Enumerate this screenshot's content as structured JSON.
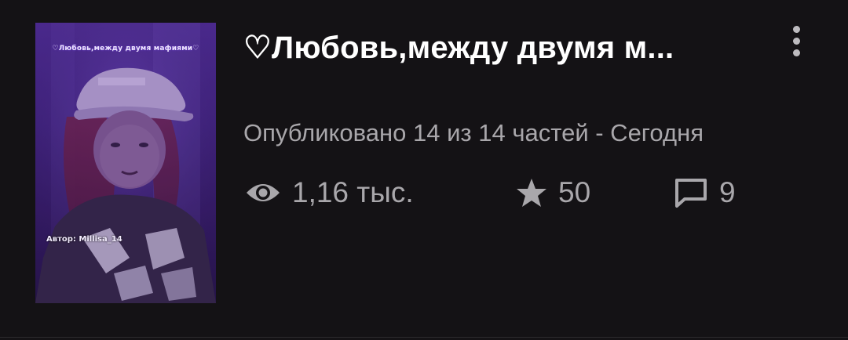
{
  "story": {
    "title": "♡Любовь,между двумя м...",
    "published": "Опубликовано 14 из 14 частей - Сегодня",
    "cover": {
      "title": "♡Любовь,между двумя мафиями♡",
      "author": "Автор: Millisa_14"
    },
    "stats": {
      "views": "1,16 тыс.",
      "votes": "50",
      "comments": "9"
    }
  },
  "icons": {
    "more": "more-vertical-icon",
    "views": "eye-icon",
    "votes": "star-icon",
    "comments": "comment-icon"
  },
  "colors": {
    "background": "#141215",
    "title": "#ffffff",
    "secondary_text": "#a9a7ab",
    "cover_accent": "#4a2a8a"
  }
}
